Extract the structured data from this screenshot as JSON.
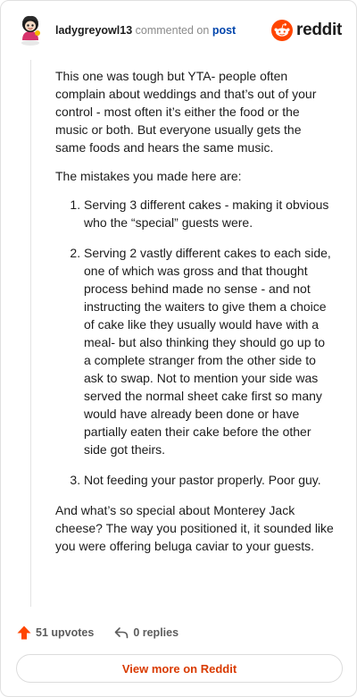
{
  "header": {
    "username": "ladygreyowl13",
    "action_text": "commented on",
    "target_text": "post",
    "brand_name": "reddit"
  },
  "comment": {
    "paragraphs": [
      "This one was tough but YTA- people often complain about weddings and that’s out of your control - most often it’s either the food or the music or both. But everyone usually gets the same foods and hears the same music.",
      "The mistakes you made here are:"
    ],
    "list": [
      "Serving 3 different cakes - making it obvious who the “special” guests were.",
      "Serving 2 vastly different cakes to each side, one of which was gross and that thought process behind made no sense - and not instructing the waiters to give them a choice of cake like they usually would have with a meal- but also thinking they should go up to a complete stranger from the other side to ask to swap. Not to mention your side was served the normal sheet cake first so many would have already been done or have partially eaten their cake before the other side got theirs.",
      "Not feeding your pastor properly. Poor guy."
    ],
    "closing": "And what’s so special about Monterey Jack cheese? The way you positioned it, it sounded like you were offering beluga caviar to your guests."
  },
  "footer": {
    "upvotes_label": "51 upvotes",
    "replies_label": "0 replies",
    "view_more_label": "View more on Reddit"
  },
  "colors": {
    "brand_orange": "#ff4500",
    "link_blue": "#0045ac",
    "cta_orange": "#d93a00"
  },
  "icons": {
    "avatar": "snoo-avatar",
    "brand": "reddit-logo-icon",
    "upvote": "upvote-arrow-icon",
    "reply": "reply-arrow-icon"
  }
}
